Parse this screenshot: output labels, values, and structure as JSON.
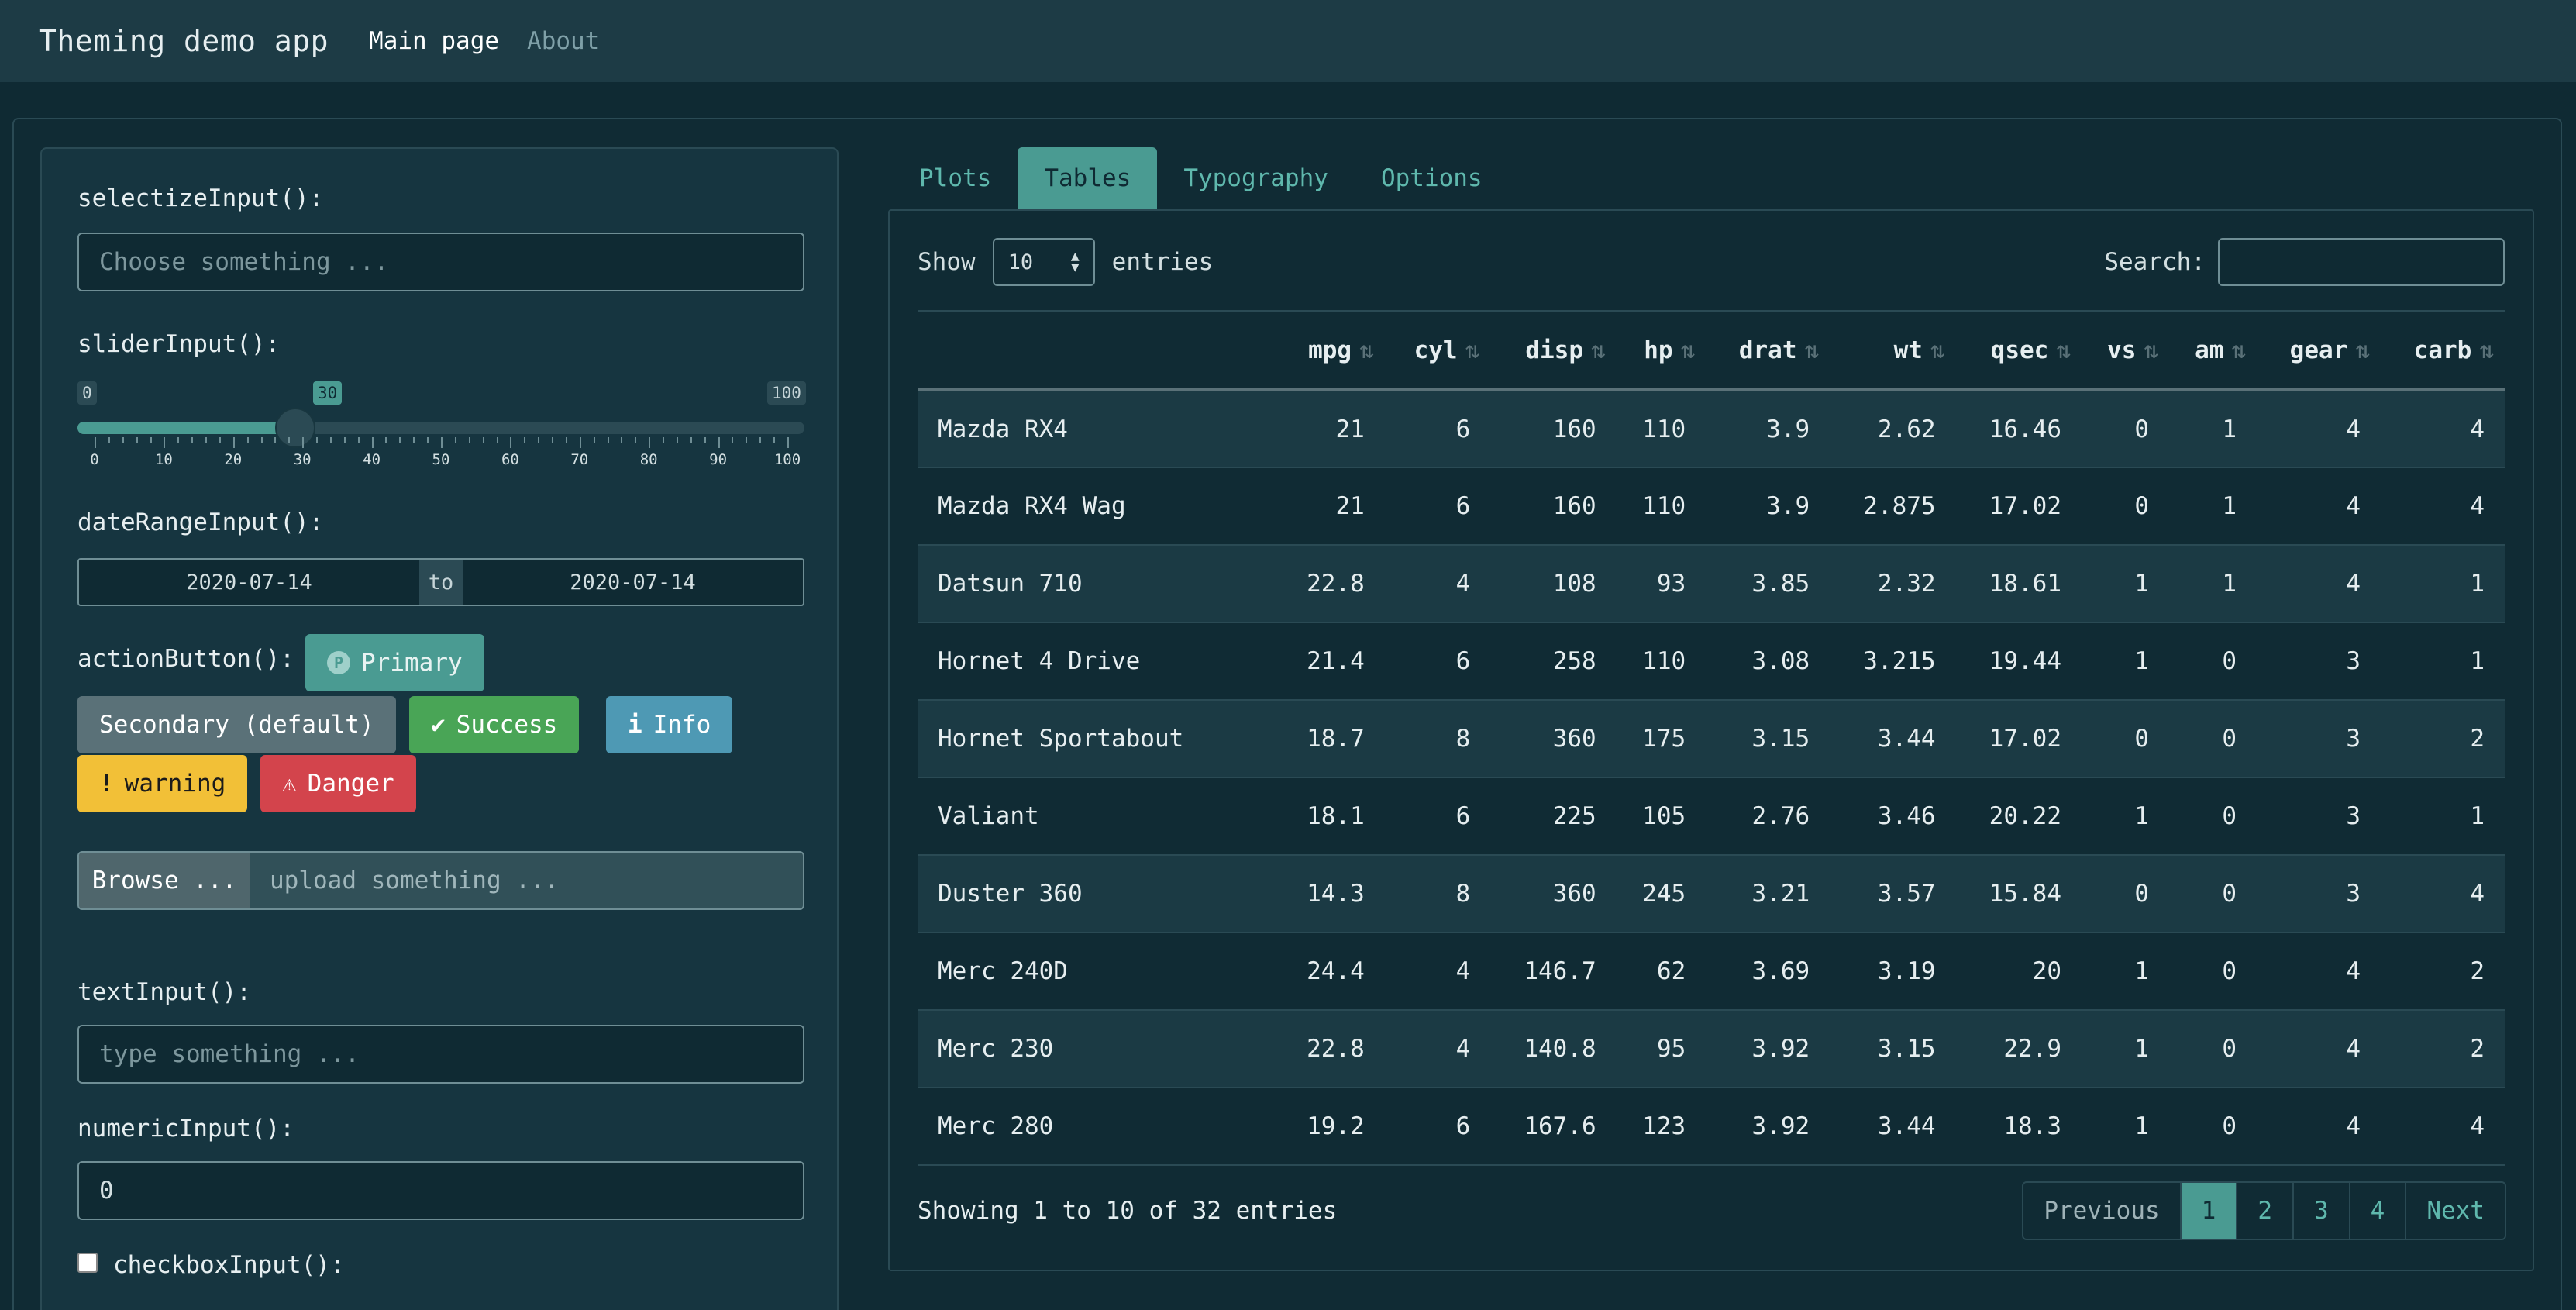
{
  "navbar": {
    "brand": "Theming demo app",
    "links": [
      "Main page",
      "About"
    ]
  },
  "sidebar": {
    "selectize_label": "selectizeInput():",
    "selectize_placeholder": "Choose something ...",
    "slider_label": "sliderInput():",
    "slider": {
      "min": 0,
      "max": 100,
      "value": 30,
      "ticks": [
        "0",
        "10",
        "20",
        "30",
        "40",
        "50",
        "60",
        "70",
        "80",
        "90",
        "100"
      ]
    },
    "slider_min_label": "0",
    "slider_max_label": "100",
    "slider_value_label": "30",
    "daterange_label": "dateRangeInput():",
    "date_start": "2020-07-14",
    "date_sep": "to",
    "date_end": "2020-07-14",
    "action_label": "actionButton():",
    "buttons": {
      "primary": "Primary",
      "secondary": "Secondary (default)",
      "success": "Success",
      "info": "Info",
      "warning": "warning",
      "danger": "Danger"
    },
    "file_button": "Browse ...",
    "file_placeholder": "upload something ...",
    "text_label": "textInput():",
    "text_placeholder": "type something ...",
    "numeric_label": "numericInput():",
    "numeric_value": "0",
    "checkbox_label": "checkboxInput():"
  },
  "tabs": [
    "Plots",
    "Tables",
    "Typography",
    "Options"
  ],
  "table_controls": {
    "show": "Show",
    "entries_value": "10",
    "entries": "entries",
    "search": "Search:"
  },
  "table": {
    "columns": [
      "",
      "mpg",
      "cyl",
      "disp",
      "hp",
      "drat",
      "wt",
      "qsec",
      "vs",
      "am",
      "gear",
      "carb"
    ],
    "rows": [
      [
        "Mazda RX4",
        "21",
        "6",
        "160",
        "110",
        "3.9",
        "2.62",
        "16.46",
        "0",
        "1",
        "4",
        "4"
      ],
      [
        "Mazda RX4 Wag",
        "21",
        "6",
        "160",
        "110",
        "3.9",
        "2.875",
        "17.02",
        "0",
        "1",
        "4",
        "4"
      ],
      [
        "Datsun 710",
        "22.8",
        "4",
        "108",
        "93",
        "3.85",
        "2.32",
        "18.61",
        "1",
        "1",
        "4",
        "1"
      ],
      [
        "Hornet 4 Drive",
        "21.4",
        "6",
        "258",
        "110",
        "3.08",
        "3.215",
        "19.44",
        "1",
        "0",
        "3",
        "1"
      ],
      [
        "Hornet Sportabout",
        "18.7",
        "8",
        "360",
        "175",
        "3.15",
        "3.44",
        "17.02",
        "0",
        "0",
        "3",
        "2"
      ],
      [
        "Valiant",
        "18.1",
        "6",
        "225",
        "105",
        "2.76",
        "3.46",
        "20.22",
        "1",
        "0",
        "3",
        "1"
      ],
      [
        "Duster 360",
        "14.3",
        "8",
        "360",
        "245",
        "3.21",
        "3.57",
        "15.84",
        "0",
        "0",
        "3",
        "4"
      ],
      [
        "Merc 240D",
        "24.4",
        "4",
        "146.7",
        "62",
        "3.69",
        "3.19",
        "20",
        "1",
        "0",
        "4",
        "2"
      ],
      [
        "Merc 230",
        "22.8",
        "4",
        "140.8",
        "95",
        "3.92",
        "3.15",
        "22.9",
        "1",
        "0",
        "4",
        "2"
      ],
      [
        "Merc 280",
        "19.2",
        "6",
        "167.6",
        "123",
        "3.92",
        "3.44",
        "18.3",
        "1",
        "0",
        "4",
        "4"
      ]
    ]
  },
  "info": "Showing 1 to 10 of 32 entries",
  "pagination": [
    "Previous",
    "1",
    "2",
    "3",
    "4",
    "Next"
  ],
  "colors": {
    "accent": "#4a9b92",
    "background": "#0f2a33",
    "navbar": "#1d3b45"
  }
}
